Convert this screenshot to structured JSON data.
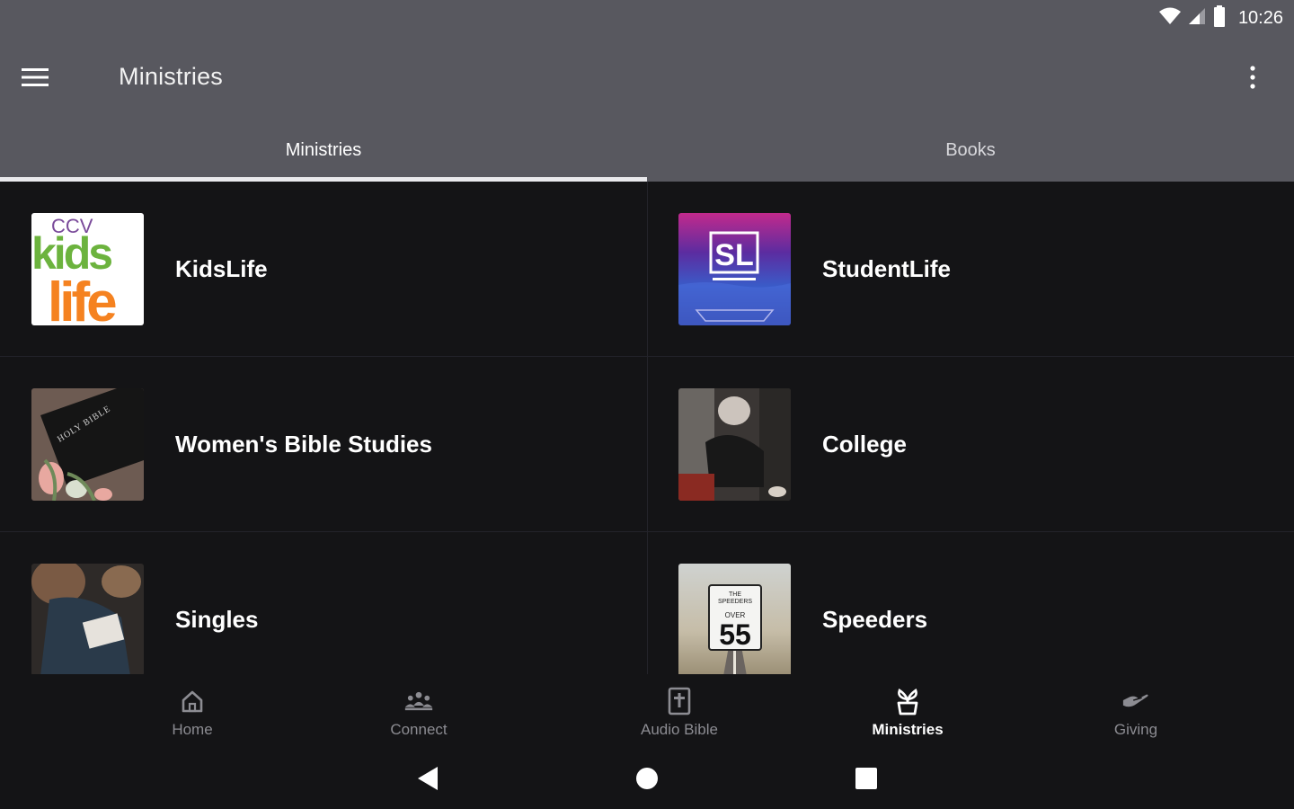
{
  "status": {
    "time": "10:26",
    "icons": [
      "wifi-icon",
      "cell-signal-icon",
      "battery-icon"
    ]
  },
  "toolbar": {
    "title": "Ministries",
    "menu_icon": "hamburger-menu-icon",
    "overflow_icon": "more-vert-icon"
  },
  "tabs": [
    {
      "label": "Ministries",
      "active": true
    },
    {
      "label": "Books",
      "active": false
    }
  ],
  "ministries": [
    {
      "label": "KidsLife",
      "thumb": "kidslife-logo",
      "thumb_text": [
        "CCV",
        "kids",
        "life"
      ]
    },
    {
      "label": "StudentLife",
      "thumb": "studentlife-logo",
      "thumb_text": [
        "SL"
      ]
    },
    {
      "label": "Women's Bible Studies",
      "thumb": "holy-bible-photo",
      "thumb_text": [
        "HOLY BIBLE"
      ]
    },
    {
      "label": "College",
      "thumb": "college-photo"
    },
    {
      "label": "Singles",
      "thumb": "singles-photo"
    },
    {
      "label": "Speeders",
      "thumb": "speeders-sign-photo",
      "thumb_text": [
        "THE",
        "SPEEDERS",
        "OVER",
        "55"
      ]
    }
  ],
  "bottom_nav": [
    {
      "label": "Home",
      "icon": "home-icon",
      "active": false
    },
    {
      "label": "Connect",
      "icon": "people-icon",
      "active": false
    },
    {
      "label": "Audio Bible",
      "icon": "bible-icon",
      "active": false
    },
    {
      "label": "Ministries",
      "icon": "plant-icon",
      "active": true
    },
    {
      "label": "Giving",
      "icon": "giving-hand-icon",
      "active": false
    }
  ],
  "colors": {
    "header": "#58585f",
    "background": "#141416",
    "kids_green": "#6cb33e",
    "kids_orange": "#f58220",
    "ccv_purple": "#7a4a9a"
  }
}
